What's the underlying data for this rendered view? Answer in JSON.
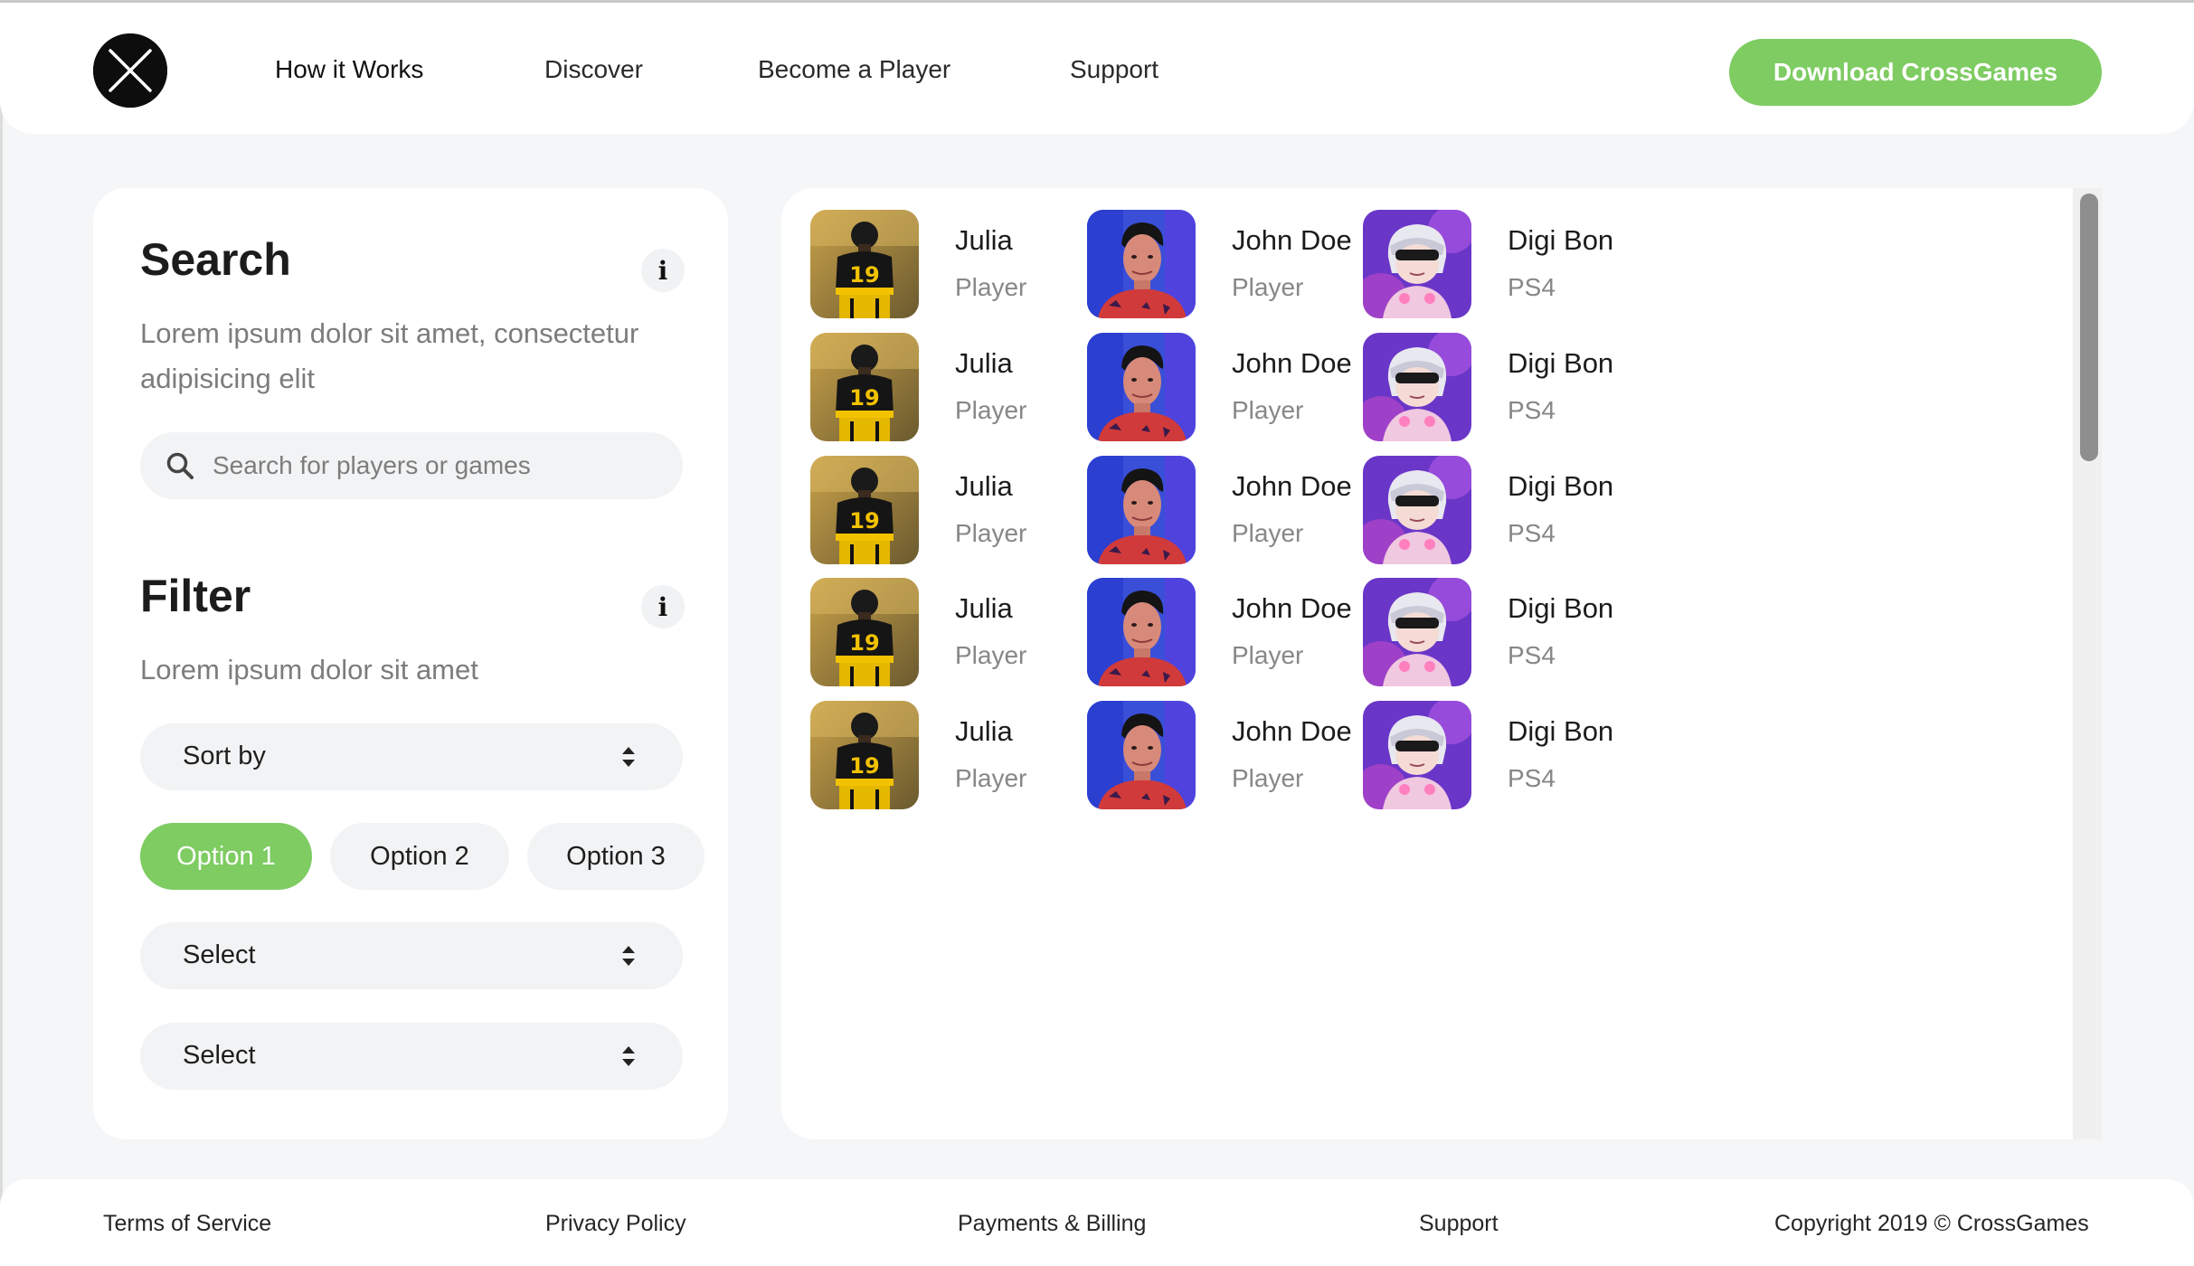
{
  "header": {
    "nav": [
      "How it Works",
      "Discover",
      "Become a Player",
      "Support"
    ],
    "download_label": "Download CrossGames"
  },
  "search": {
    "title": "Search",
    "description": "Lorem ipsum dolor sit amet, consectetur adipisicing elit",
    "placeholder": "Search for players or games"
  },
  "filter": {
    "title": "Filter",
    "description": "Lorem ipsum dolor sit amet",
    "sort_label": "Sort by",
    "options": [
      "Option 1",
      "Option 2",
      "Option 3"
    ],
    "selected_option": "Option 1",
    "select_1": "Select",
    "select_2": "Select"
  },
  "players": [
    [
      {
        "name": "Julia",
        "role": "Player",
        "avatar": "football-player"
      },
      {
        "name": "John Doe",
        "role": "Player",
        "avatar": "man-portrait"
      },
      {
        "name": "Digi Bon",
        "role": "PS4",
        "avatar": "anime-character"
      }
    ],
    [
      {
        "name": "Julia",
        "role": "Player",
        "avatar": "football-player"
      },
      {
        "name": "John Doe",
        "role": "Player",
        "avatar": "man-portrait"
      },
      {
        "name": "Digi Bon",
        "role": "PS4",
        "avatar": "anime-character"
      }
    ],
    [
      {
        "name": "Julia",
        "role": "Player",
        "avatar": "football-player"
      },
      {
        "name": "John Doe",
        "role": "Player",
        "avatar": "man-portrait"
      },
      {
        "name": "Digi Bon",
        "role": "PS4",
        "avatar": "anime-character"
      }
    ],
    [
      {
        "name": "Julia",
        "role": "Player",
        "avatar": "football-player"
      },
      {
        "name": "John Doe",
        "role": "Player",
        "avatar": "man-portrait"
      },
      {
        "name": "Digi Bon",
        "role": "PS4",
        "avatar": "anime-character"
      }
    ],
    [
      {
        "name": "Julia",
        "role": "Player",
        "avatar": "football-player"
      },
      {
        "name": "John Doe",
        "role": "Player",
        "avatar": "man-portrait"
      },
      {
        "name": "Digi Bon",
        "role": "PS4",
        "avatar": "anime-character"
      }
    ]
  ],
  "footer": {
    "links": [
      "Terms of Service",
      "Privacy Policy",
      "Payments & Billing",
      "Support"
    ],
    "copyright": "Copyright 2019 © CrossGames"
  },
  "colors": {
    "accent": "#7ecc62",
    "background": "#f5f6f7",
    "panel": "#ffffff"
  }
}
